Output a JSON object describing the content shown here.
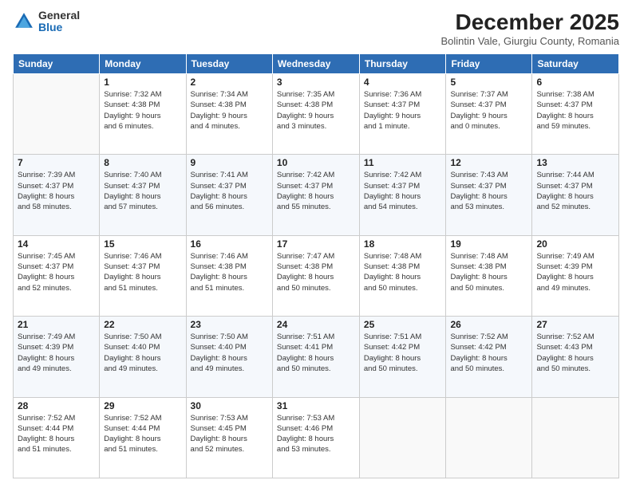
{
  "logo": {
    "general": "General",
    "blue": "Blue"
  },
  "header": {
    "title": "December 2025",
    "subtitle": "Bolintin Vale, Giurgiu County, Romania"
  },
  "columns": [
    "Sunday",
    "Monday",
    "Tuesday",
    "Wednesday",
    "Thursday",
    "Friday",
    "Saturday"
  ],
  "weeks": [
    [
      {
        "day": "",
        "info": ""
      },
      {
        "day": "1",
        "info": "Sunrise: 7:32 AM\nSunset: 4:38 PM\nDaylight: 9 hours\nand 6 minutes."
      },
      {
        "day": "2",
        "info": "Sunrise: 7:34 AM\nSunset: 4:38 PM\nDaylight: 9 hours\nand 4 minutes."
      },
      {
        "day": "3",
        "info": "Sunrise: 7:35 AM\nSunset: 4:38 PM\nDaylight: 9 hours\nand 3 minutes."
      },
      {
        "day": "4",
        "info": "Sunrise: 7:36 AM\nSunset: 4:37 PM\nDaylight: 9 hours\nand 1 minute."
      },
      {
        "day": "5",
        "info": "Sunrise: 7:37 AM\nSunset: 4:37 PM\nDaylight: 9 hours\nand 0 minutes."
      },
      {
        "day": "6",
        "info": "Sunrise: 7:38 AM\nSunset: 4:37 PM\nDaylight: 8 hours\nand 59 minutes."
      }
    ],
    [
      {
        "day": "7",
        "info": "Sunrise: 7:39 AM\nSunset: 4:37 PM\nDaylight: 8 hours\nand 58 minutes."
      },
      {
        "day": "8",
        "info": "Sunrise: 7:40 AM\nSunset: 4:37 PM\nDaylight: 8 hours\nand 57 minutes."
      },
      {
        "day": "9",
        "info": "Sunrise: 7:41 AM\nSunset: 4:37 PM\nDaylight: 8 hours\nand 56 minutes."
      },
      {
        "day": "10",
        "info": "Sunrise: 7:42 AM\nSunset: 4:37 PM\nDaylight: 8 hours\nand 55 minutes."
      },
      {
        "day": "11",
        "info": "Sunrise: 7:42 AM\nSunset: 4:37 PM\nDaylight: 8 hours\nand 54 minutes."
      },
      {
        "day": "12",
        "info": "Sunrise: 7:43 AM\nSunset: 4:37 PM\nDaylight: 8 hours\nand 53 minutes."
      },
      {
        "day": "13",
        "info": "Sunrise: 7:44 AM\nSunset: 4:37 PM\nDaylight: 8 hours\nand 52 minutes."
      }
    ],
    [
      {
        "day": "14",
        "info": "Sunrise: 7:45 AM\nSunset: 4:37 PM\nDaylight: 8 hours\nand 52 minutes."
      },
      {
        "day": "15",
        "info": "Sunrise: 7:46 AM\nSunset: 4:37 PM\nDaylight: 8 hours\nand 51 minutes."
      },
      {
        "day": "16",
        "info": "Sunrise: 7:46 AM\nSunset: 4:38 PM\nDaylight: 8 hours\nand 51 minutes."
      },
      {
        "day": "17",
        "info": "Sunrise: 7:47 AM\nSunset: 4:38 PM\nDaylight: 8 hours\nand 50 minutes."
      },
      {
        "day": "18",
        "info": "Sunrise: 7:48 AM\nSunset: 4:38 PM\nDaylight: 8 hours\nand 50 minutes."
      },
      {
        "day": "19",
        "info": "Sunrise: 7:48 AM\nSunset: 4:38 PM\nDaylight: 8 hours\nand 50 minutes."
      },
      {
        "day": "20",
        "info": "Sunrise: 7:49 AM\nSunset: 4:39 PM\nDaylight: 8 hours\nand 49 minutes."
      }
    ],
    [
      {
        "day": "21",
        "info": "Sunrise: 7:49 AM\nSunset: 4:39 PM\nDaylight: 8 hours\nand 49 minutes."
      },
      {
        "day": "22",
        "info": "Sunrise: 7:50 AM\nSunset: 4:40 PM\nDaylight: 8 hours\nand 49 minutes."
      },
      {
        "day": "23",
        "info": "Sunrise: 7:50 AM\nSunset: 4:40 PM\nDaylight: 8 hours\nand 49 minutes."
      },
      {
        "day": "24",
        "info": "Sunrise: 7:51 AM\nSunset: 4:41 PM\nDaylight: 8 hours\nand 50 minutes."
      },
      {
        "day": "25",
        "info": "Sunrise: 7:51 AM\nSunset: 4:42 PM\nDaylight: 8 hours\nand 50 minutes."
      },
      {
        "day": "26",
        "info": "Sunrise: 7:52 AM\nSunset: 4:42 PM\nDaylight: 8 hours\nand 50 minutes."
      },
      {
        "day": "27",
        "info": "Sunrise: 7:52 AM\nSunset: 4:43 PM\nDaylight: 8 hours\nand 50 minutes."
      }
    ],
    [
      {
        "day": "28",
        "info": "Sunrise: 7:52 AM\nSunset: 4:44 PM\nDaylight: 8 hours\nand 51 minutes."
      },
      {
        "day": "29",
        "info": "Sunrise: 7:52 AM\nSunset: 4:44 PM\nDaylight: 8 hours\nand 51 minutes."
      },
      {
        "day": "30",
        "info": "Sunrise: 7:53 AM\nSunset: 4:45 PM\nDaylight: 8 hours\nand 52 minutes."
      },
      {
        "day": "31",
        "info": "Sunrise: 7:53 AM\nSunset: 4:46 PM\nDaylight: 8 hours\nand 53 minutes."
      },
      {
        "day": "",
        "info": ""
      },
      {
        "day": "",
        "info": ""
      },
      {
        "day": "",
        "info": ""
      }
    ]
  ]
}
